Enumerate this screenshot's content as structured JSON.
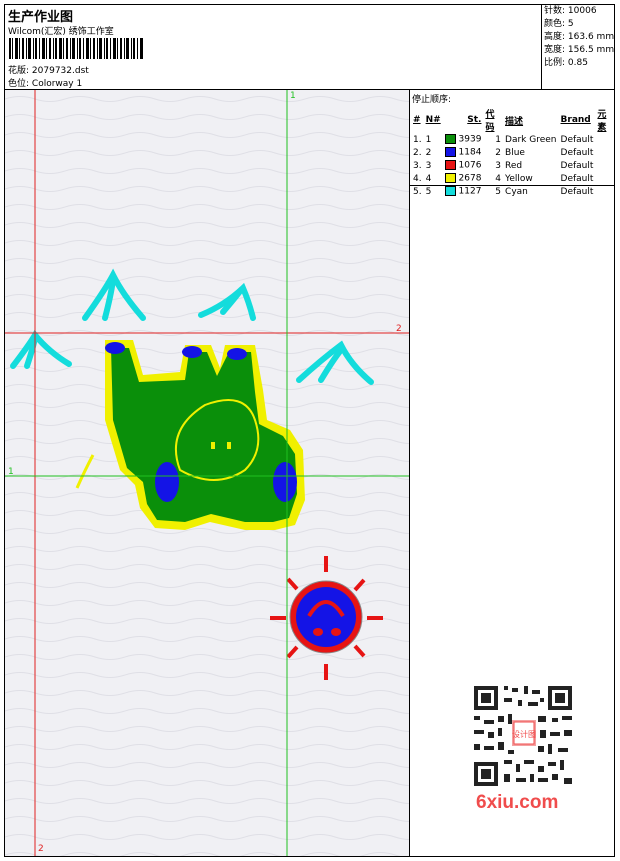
{
  "header": {
    "title": "生产作业图",
    "company": "Wilcom(汇宏) 绣饰工作室",
    "design_label": "花版:",
    "design_file": "2079732.dst",
    "colorway_label": "色位:",
    "colorway": "Colorway 1"
  },
  "stats": [
    {
      "label": "针数:",
      "value": "10006"
    },
    {
      "label": "颜色:",
      "value": "5"
    },
    {
      "label": "高度:",
      "value": "163.6 mm"
    },
    {
      "label": "宽度:",
      "value": "156.5 mm"
    },
    {
      "label": "比例:",
      "value": "0.85"
    }
  ],
  "stop_sequence": {
    "title": "停止顺序:",
    "columns": [
      "#",
      "N#",
      "St.",
      "代码",
      "描述",
      "Brand",
      "元素"
    ],
    "rows": [
      {
        "idx": "1.",
        "n": "1",
        "color": "#0a8f0a",
        "code": "3939",
        "st": "1",
        "desc": "Dark Green",
        "brand": "Default"
      },
      {
        "idx": "2.",
        "n": "2",
        "color": "#1414e6",
        "code": "1184",
        "st": "2",
        "desc": "Blue",
        "brand": "Default"
      },
      {
        "idx": "3.",
        "n": "3",
        "color": "#e61414",
        "code": "1076",
        "st": "3",
        "desc": "Red",
        "brand": "Default"
      },
      {
        "idx": "4.",
        "n": "4",
        "color": "#f0f000",
        "code": "2678",
        "st": "4",
        "desc": "Yellow",
        "brand": "Default"
      },
      {
        "idx": "5.",
        "n": "5",
        "color": "#14dcdc",
        "code": "1127",
        "st": "5",
        "desc": "Cyan",
        "brand": "Default"
      }
    ]
  },
  "guides": {
    "v1": "1",
    "v2": "2",
    "h1": "1",
    "h2": "2"
  },
  "watermark": {
    "site": "6xiu.com",
    "stamp": "设计图"
  },
  "colors": {
    "guide_red": "#e02020",
    "guide_green": "#20c020",
    "dark_green": "#0a8f0a",
    "blue": "#1414e6",
    "red": "#e61414",
    "yellow": "#f0f000",
    "cyan": "#14dcdc",
    "logo": "#f04c4c"
  }
}
